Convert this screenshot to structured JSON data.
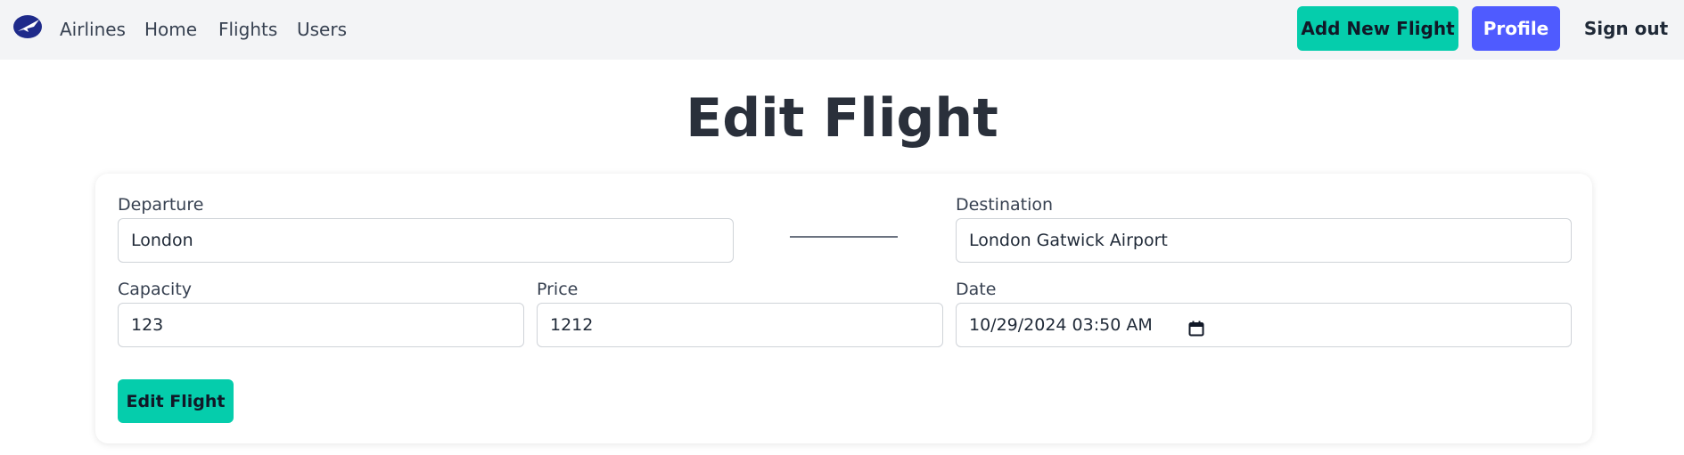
{
  "nav": {
    "brand": "Airlines",
    "links": [
      "Home",
      "Flights",
      "Users"
    ],
    "add_flight": "Add New Flight",
    "profile": "Profile",
    "sign_out": "Sign out"
  },
  "page": {
    "title": "Edit Flight"
  },
  "form": {
    "departure_label": "Departure",
    "departure_value": "London",
    "destination_label": "Destination",
    "destination_value": "London Gatwick Airport",
    "capacity_label": "Capacity",
    "capacity_value": "123",
    "price_label": "Price",
    "price_value": "1212",
    "date_label": "Date",
    "date_value": "10/29/2024 03:50 AM",
    "submit": "Edit Flight"
  },
  "colors": {
    "accent_green": "#05cdac",
    "accent_blue": "#4f5bff",
    "logo_navy": "#1e2a8a"
  },
  "icons": {
    "logo": "airplane-logo-icon",
    "date": "calendar-icon"
  }
}
